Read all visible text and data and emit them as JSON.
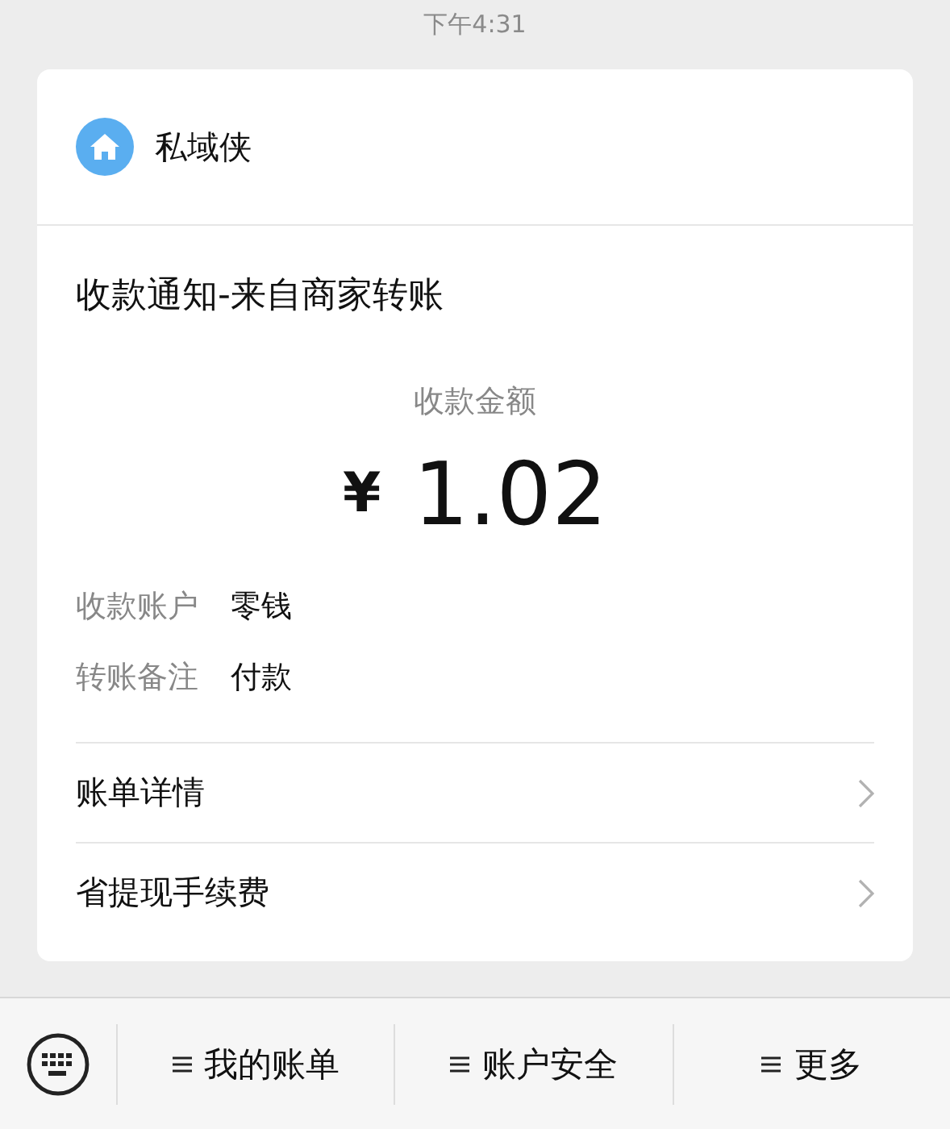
{
  "time": "下午4:31",
  "card": {
    "sender": "私域侠",
    "title": "收款通知-来自商家转账",
    "amount_label": "收款金额",
    "currency": "¥",
    "amount": "1.02",
    "details": [
      {
        "label": "收款账户",
        "value": "零钱"
      },
      {
        "label": "转账备注",
        "value": "付款"
      }
    ],
    "links": [
      {
        "label": "账单详情"
      },
      {
        "label": "省提现手续费"
      }
    ]
  },
  "menu": [
    {
      "label": "我的账单"
    },
    {
      "label": "账户安全"
    },
    {
      "label": "更多"
    }
  ]
}
